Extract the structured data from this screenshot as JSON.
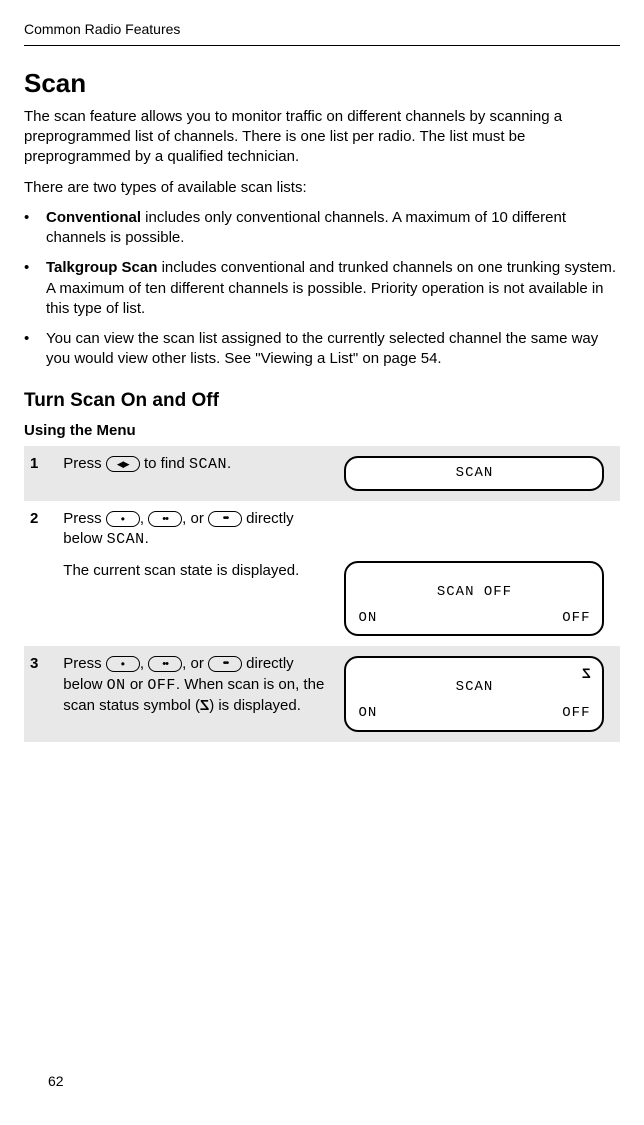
{
  "header": {
    "label": "Common Radio Features"
  },
  "section": {
    "title": "Scan",
    "intro": "The scan feature allows you to monitor traffic on different channels by scanning a preprogrammed list of channels. There is one list per radio. The list must be preprogrammed by a qualified technician.",
    "types_lead": "There are two types of available scan lists:",
    "bullets": [
      {
        "bold": "Conventional",
        "rest": " includes only conventional channels. A maximum of 10 different channels is possible."
      },
      {
        "bold": "Talkgroup Scan",
        "rest": " includes conventional and trunked channels on one trunking system. A maximum of ten different channels is possible. Priority operation is not available in this type of list."
      },
      {
        "bold": "",
        "rest": "You can view the scan list assigned to the currently selected channel the same way you would view other lists. See \"Viewing a List\" on page 54."
      }
    ]
  },
  "subsection": {
    "title": "Turn Scan On and Off",
    "method": "Using the Menu"
  },
  "steps": [
    {
      "num": "1",
      "text_a": "Press ",
      "text_b": " to find ",
      "mono1": "SCAN",
      "text_c": ".",
      "lcd1": {
        "line1": "SCAN"
      }
    },
    {
      "num": "2",
      "text_a": "Press ",
      "text_b": ", ",
      "text_c": ", or ",
      "text_d": " directly below ",
      "mono1": "SCAN",
      "text_e": ".",
      "para2": "The current scan state is displayed.",
      "lcd": {
        "line1": "SCAN OFF",
        "left": "ON",
        "right": "OFF"
      }
    },
    {
      "num": "3",
      "text_a": "Press ",
      "text_b": ", ",
      "text_c": ", or ",
      "text_d": " directly below ",
      "mono1": "ON",
      "text_e": " or ",
      "mono2": "OFF",
      "text_f": ". When scan is on, the scan status symbol (",
      "text_g": ") is displayed.",
      "lcd": {
        "sym": "Z",
        "line1": "SCAN",
        "left": "ON",
        "right": "OFF"
      }
    }
  ],
  "page_number": "62"
}
